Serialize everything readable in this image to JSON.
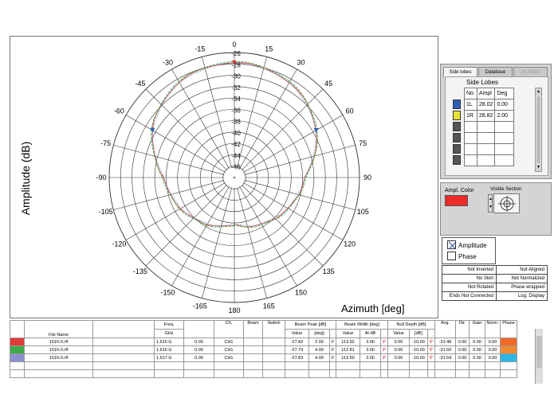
{
  "polar": {
    "ylabel": "Amplitude  (dB)",
    "xlabel": "Azimuth  [deg]",
    "angle_labels": [
      {
        "deg": 0,
        "text": "0"
      },
      {
        "deg": 15,
        "text": "15"
      },
      {
        "deg": 30,
        "text": "30"
      },
      {
        "deg": 45,
        "text": "45"
      },
      {
        "deg": 60,
        "text": "60"
      },
      {
        "deg": 75,
        "text": "75"
      },
      {
        "deg": 90,
        "text": "90"
      },
      {
        "deg": 105,
        "text": "105"
      },
      {
        "deg": 120,
        "text": "120"
      },
      {
        "deg": 135,
        "text": "135"
      },
      {
        "deg": 150,
        "text": "150"
      },
      {
        "deg": 165,
        "text": "165"
      },
      {
        "deg": 180,
        "text": "180"
      },
      {
        "deg": -15,
        "text": "-15"
      },
      {
        "deg": -30,
        "text": "-30"
      },
      {
        "deg": -45,
        "text": "-45"
      },
      {
        "deg": -60,
        "text": "-60"
      },
      {
        "deg": -75,
        "text": "-75"
      },
      {
        "deg": -90,
        "text": "-90"
      },
      {
        "deg": -105,
        "text": "-105"
      },
      {
        "deg": -120,
        "text": "-120"
      },
      {
        "deg": -135,
        "text": "-135"
      },
      {
        "deg": -150,
        "text": "-150"
      },
      {
        "deg": -165,
        "text": "-165"
      }
    ],
    "ring_labels": [
      "-26",
      "-28",
      "-30",
      "-32",
      "-34",
      "-36",
      "-38",
      "-40",
      "-42",
      "-44",
      "-46"
    ],
    "colors": {
      "red": "#e23b2e",
      "green": "#2fa84a",
      "blue": "#5e7fd0",
      "grid": "#333333"
    }
  },
  "side_lobes": {
    "tabs": [
      "Side lobes",
      "Database",
      "Ax.Ratio"
    ],
    "title": "Side Lobes",
    "headers": [
      "No.",
      "Ampl",
      "Deg"
    ],
    "rows": [
      [
        "1L",
        "28.02",
        "0.00"
      ],
      [
        "1R",
        "28.82",
        "2.00"
      ],
      [
        "",
        "",
        ""
      ],
      [
        "",
        "",
        ""
      ],
      [
        "",
        "",
        ""
      ],
      [
        "",
        "",
        ""
      ]
    ],
    "swatch_colors": [
      "#2f5db8",
      "#e6e23a",
      "#555555",
      "#555555",
      "#555555",
      "#555555"
    ]
  },
  "settings": {
    "ampl_color_label": "Ampl. Color",
    "ampl_color": "#ee2a2a",
    "visible_section_label": "Visible Section"
  },
  "legend": {
    "amplitude": "Amplitude",
    "phase": "Phase"
  },
  "status": [
    [
      "Not Inverted",
      "Not Aligned"
    ],
    [
      "No Skirt",
      "Not Normalized"
    ],
    [
      "Not Rotated",
      "Phase wrapped"
    ],
    [
      "Ends Not Connected",
      "Log. Display"
    ]
  ],
  "table": {
    "h1": {
      "file": "File Name",
      "freq": "Freq.",
      "ch": "Ch.",
      "beam": "Beam",
      "switch": "Switch",
      "peak": "Beam Peak [dB]",
      "width": "Beam Width [deg]",
      "null": "Null Depth [dB]",
      "avg": "Avg.",
      "dir": "Dir.",
      "gain": "Gain",
      "norm": "Norm.",
      "phase": "Phase"
    },
    "h2": {
      "freq_unit": "GHz",
      "value": "Value",
      "deg": "[deg]",
      "value2": "Value",
      "at": "At dB",
      "value3": "Value",
      "db": "[dB]"
    },
    "rows": [
      {
        "color": "#e03a3a",
        "phase_color": "#f26a28",
        "file": "1616-0.rff",
        "freq": "1.615",
        "g": "G",
        "f2": "0.00",
        "ch": "CH1",
        "pk": "-27.82",
        "pk_deg": "2.00",
        "pf": "F",
        "bw": "113.92",
        "at": "3.00",
        "wp": "P",
        "nv": "0.00",
        "nd": "-10.00",
        "np": "P",
        "avg": "-31.48",
        "dir": "0.00",
        "gain": "0.00",
        "norm": "0.00"
      },
      {
        "color": "#3cab4a",
        "phase_color": "#f28a30",
        "file": "1616-0.rff",
        "freq": "1.616",
        "g": "G",
        "f2": "0.00",
        "ch": "CH1",
        "pk": "-27.79",
        "pk_deg": "4.00",
        "pf": "F",
        "bw": "112.81",
        "at": "3.00",
        "wp": "P",
        "nv": "0.00",
        "nd": "-10.00",
        "np": "P",
        "avg": "-31.50",
        "dir": "0.00",
        "gain": "0.00",
        "norm": "0.00"
      },
      {
        "color": "#8c8fd0",
        "phase_color": "#2cb6e6",
        "file": "1616-0.rff",
        "freq": "1.617",
        "g": "G",
        "f2": "0.00",
        "ch": "CH1",
        "pk": "-27.83",
        "pk_deg": "4.00",
        "pf": "F",
        "bw": "113.50",
        "at": "3.00",
        "wp": "P",
        "nv": "0.00",
        "nd": "-10.00",
        "np": "P",
        "avg": "-31.54",
        "dir": "0.00",
        "gain": "0.00",
        "norm": "0.00"
      }
    ]
  }
}
